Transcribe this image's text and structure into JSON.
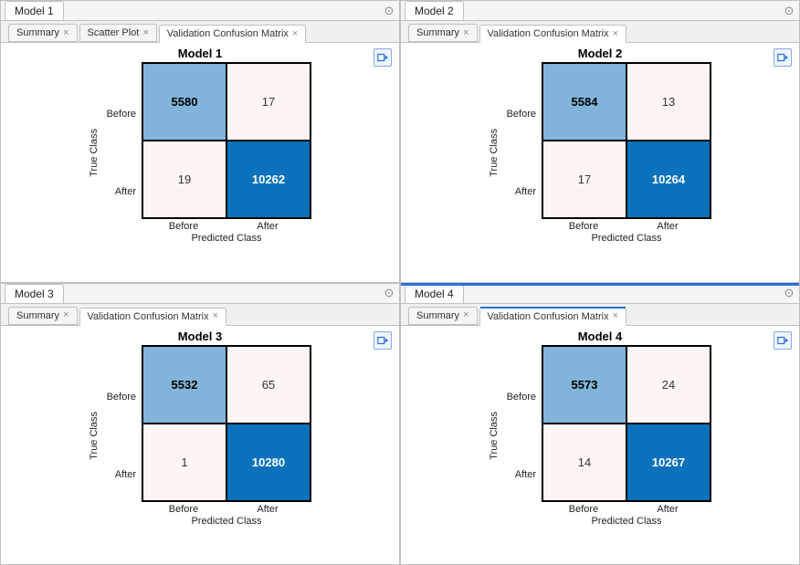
{
  "panels": [
    {
      "header_tab": "Model 1",
      "subtabs": [
        {
          "label": "Summary",
          "active": false
        },
        {
          "label": "Scatter Plot",
          "active": false
        },
        {
          "label": "Validation Confusion Matrix",
          "active": true
        }
      ],
      "plot_title": "Model 1",
      "ylabel": "True Class",
      "xlabel": "Predicted Class",
      "row_labels": [
        "Before",
        "After"
      ],
      "col_labels": [
        "Before",
        "After"
      ],
      "cells": {
        "tl": "5580",
        "tr": "17",
        "bl": "19",
        "br": "10262"
      },
      "highlight": false,
      "subtab_underline": false
    },
    {
      "header_tab": "Model 2",
      "subtabs": [
        {
          "label": "Summary",
          "active": false
        },
        {
          "label": "Validation Confusion Matrix",
          "active": true
        }
      ],
      "plot_title": "Model 2",
      "ylabel": "True Class",
      "xlabel": "Predicted Class",
      "row_labels": [
        "Before",
        "After"
      ],
      "col_labels": [
        "Before",
        "After"
      ],
      "cells": {
        "tl": "5584",
        "tr": "13",
        "bl": "17",
        "br": "10264"
      },
      "highlight": false,
      "subtab_underline": false
    },
    {
      "header_tab": "Model 3",
      "subtabs": [
        {
          "label": "Summary",
          "active": false
        },
        {
          "label": "Validation Confusion Matrix",
          "active": true
        }
      ],
      "plot_title": "Model 3",
      "ylabel": "True Class",
      "xlabel": "Predicted Class",
      "row_labels": [
        "Before",
        "After"
      ],
      "col_labels": [
        "Before",
        "After"
      ],
      "cells": {
        "tl": "5532",
        "tr": "65",
        "bl": "1",
        "br": "10280"
      },
      "highlight": false,
      "subtab_underline": false
    },
    {
      "header_tab": "Model 4",
      "subtabs": [
        {
          "label": "Summary",
          "active": false
        },
        {
          "label": "Validation Confusion Matrix",
          "active": true
        }
      ],
      "plot_title": "Model 4",
      "ylabel": "True Class",
      "xlabel": "Predicted Class",
      "row_labels": [
        "Before",
        "After"
      ],
      "col_labels": [
        "Before",
        "After"
      ],
      "cells": {
        "tl": "5573",
        "tr": "24",
        "bl": "14",
        "br": "10267"
      },
      "highlight": true,
      "subtab_underline": true
    }
  ],
  "chart_data": [
    {
      "type": "heatmap",
      "title": "Model 1",
      "xlabel": "Predicted Class",
      "ylabel": "True Class",
      "x_categories": [
        "Before",
        "After"
      ],
      "y_categories": [
        "Before",
        "After"
      ],
      "values": [
        [
          5580,
          17
        ],
        [
          19,
          10262
        ]
      ]
    },
    {
      "type": "heatmap",
      "title": "Model 2",
      "xlabel": "Predicted Class",
      "ylabel": "True Class",
      "x_categories": [
        "Before",
        "After"
      ],
      "y_categories": [
        "Before",
        "After"
      ],
      "values": [
        [
          5584,
          13
        ],
        [
          17,
          10264
        ]
      ]
    },
    {
      "type": "heatmap",
      "title": "Model 3",
      "xlabel": "Predicted Class",
      "ylabel": "True Class",
      "x_categories": [
        "Before",
        "After"
      ],
      "y_categories": [
        "Before",
        "After"
      ],
      "values": [
        [
          5532,
          65
        ],
        [
          1,
          10280
        ]
      ]
    },
    {
      "type": "heatmap",
      "title": "Model 4",
      "xlabel": "Predicted Class",
      "ylabel": "True Class",
      "x_categories": [
        "Before",
        "After"
      ],
      "y_categories": [
        "Before",
        "After"
      ],
      "values": [
        [
          5573,
          24
        ],
        [
          14,
          10267
        ]
      ]
    }
  ]
}
